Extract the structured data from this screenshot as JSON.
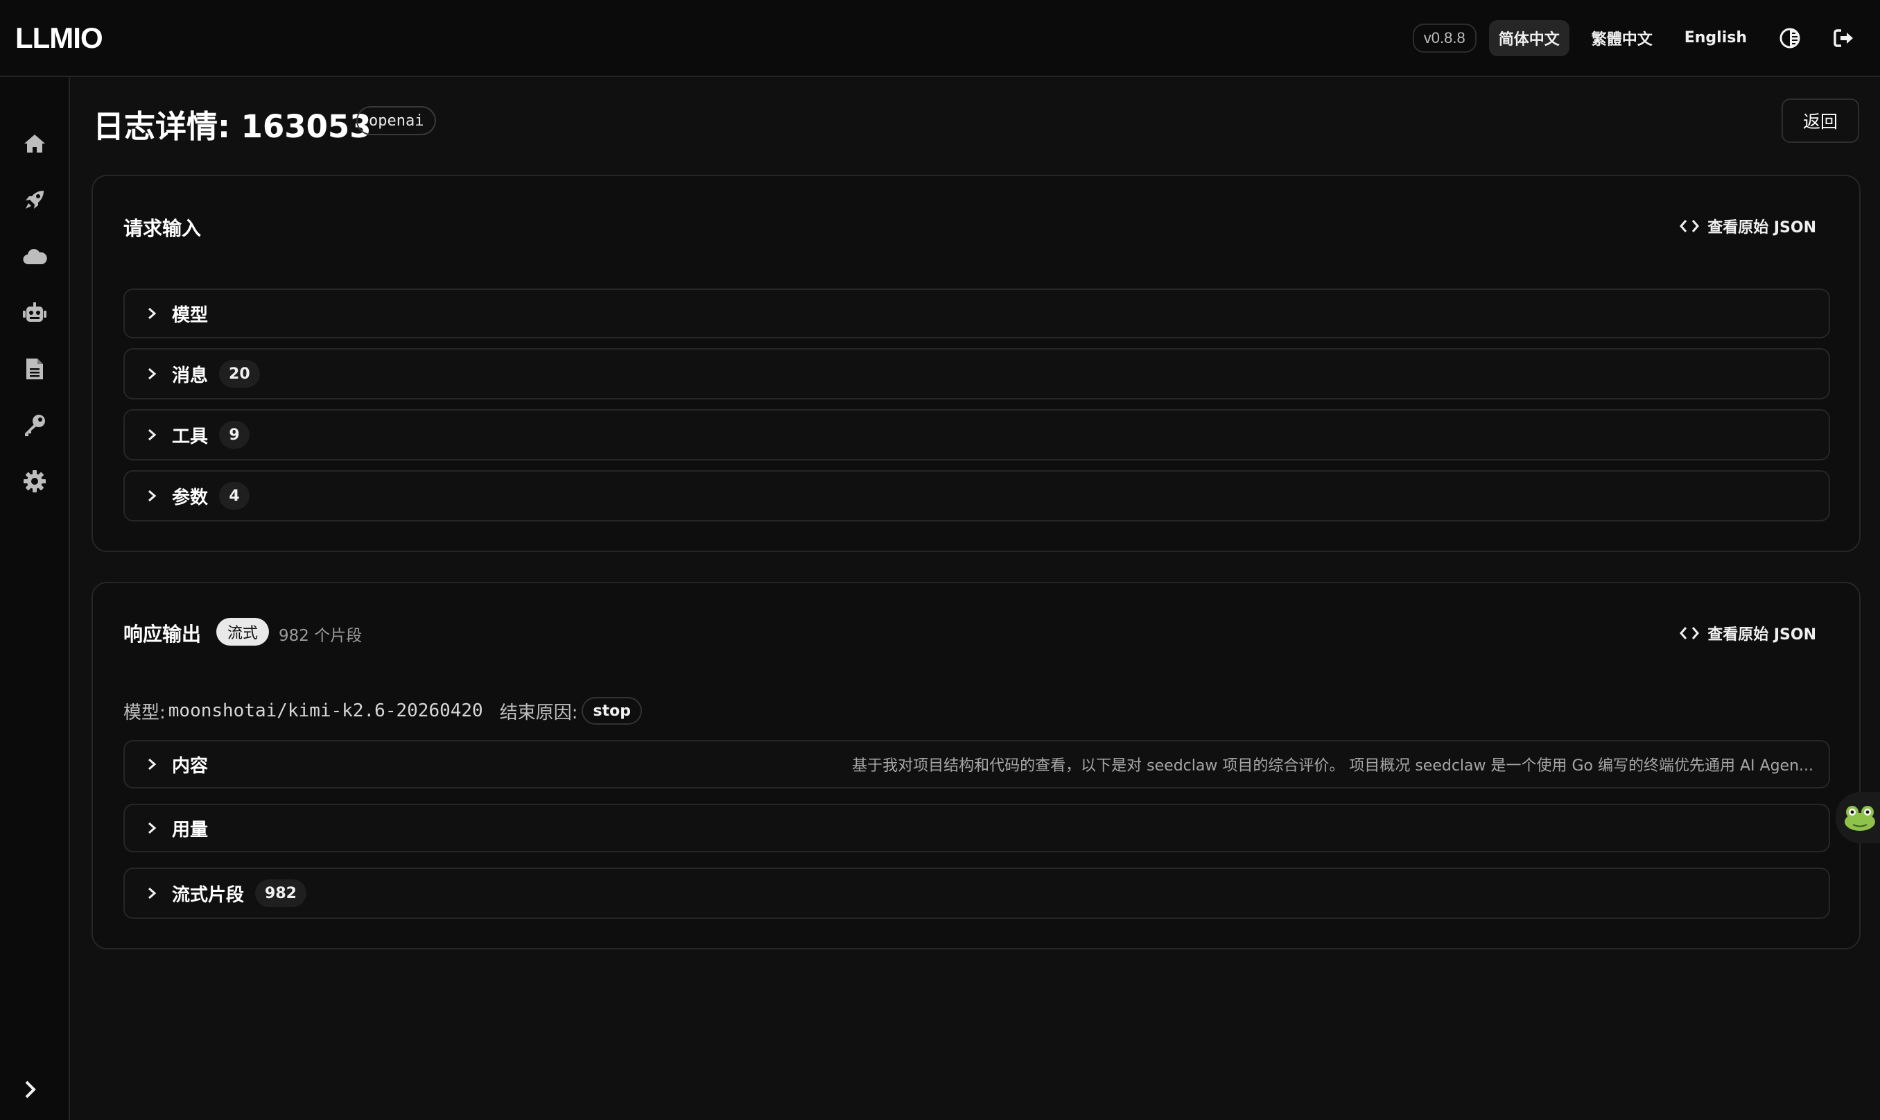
{
  "app": {
    "logo": "LLMIO",
    "version": "v0.8.8"
  },
  "header": {
    "languages": [
      "简体中文",
      "繁體中文",
      "English"
    ],
    "active_language": "简体中文"
  },
  "page": {
    "title": "日志详情: 163053",
    "provider": "openai",
    "back_label": "返回"
  },
  "request": {
    "title": "请求输入",
    "raw_json_label": "查看原始 JSON",
    "rows": [
      {
        "label": "模型"
      },
      {
        "label": "消息",
        "count": "20"
      },
      {
        "label": "工具",
        "count": "9"
      },
      {
        "label": "参数",
        "count": "4"
      }
    ]
  },
  "response": {
    "title": "响应输出",
    "stream_badge": "流式",
    "chunks_text": "982 个片段",
    "raw_json_label": "查看原始 JSON",
    "model_label": "模型:",
    "model_value": "moonshotai/kimi-k2.6-20260420",
    "finish_label": "结束原因:",
    "finish_value": "stop",
    "rows": [
      {
        "label": "内容",
        "preview": "基于我对项目结构和代码的查看，以下是对 seedclaw 项目的综合评价。 项目概况 seedclaw 是一个使用 Go 编写的终端优先通用 AI Agen..."
      },
      {
        "label": "用量"
      },
      {
        "label": "流式片段",
        "count": "982"
      }
    ]
  },
  "icons": {
    "sidebar": [
      "home-icon",
      "rocket-icon",
      "cloud-icon",
      "robot-icon",
      "document-icon",
      "key-icon",
      "gear-icon"
    ],
    "topbar": [
      "theme-toggle-icon",
      "logout-icon"
    ]
  }
}
